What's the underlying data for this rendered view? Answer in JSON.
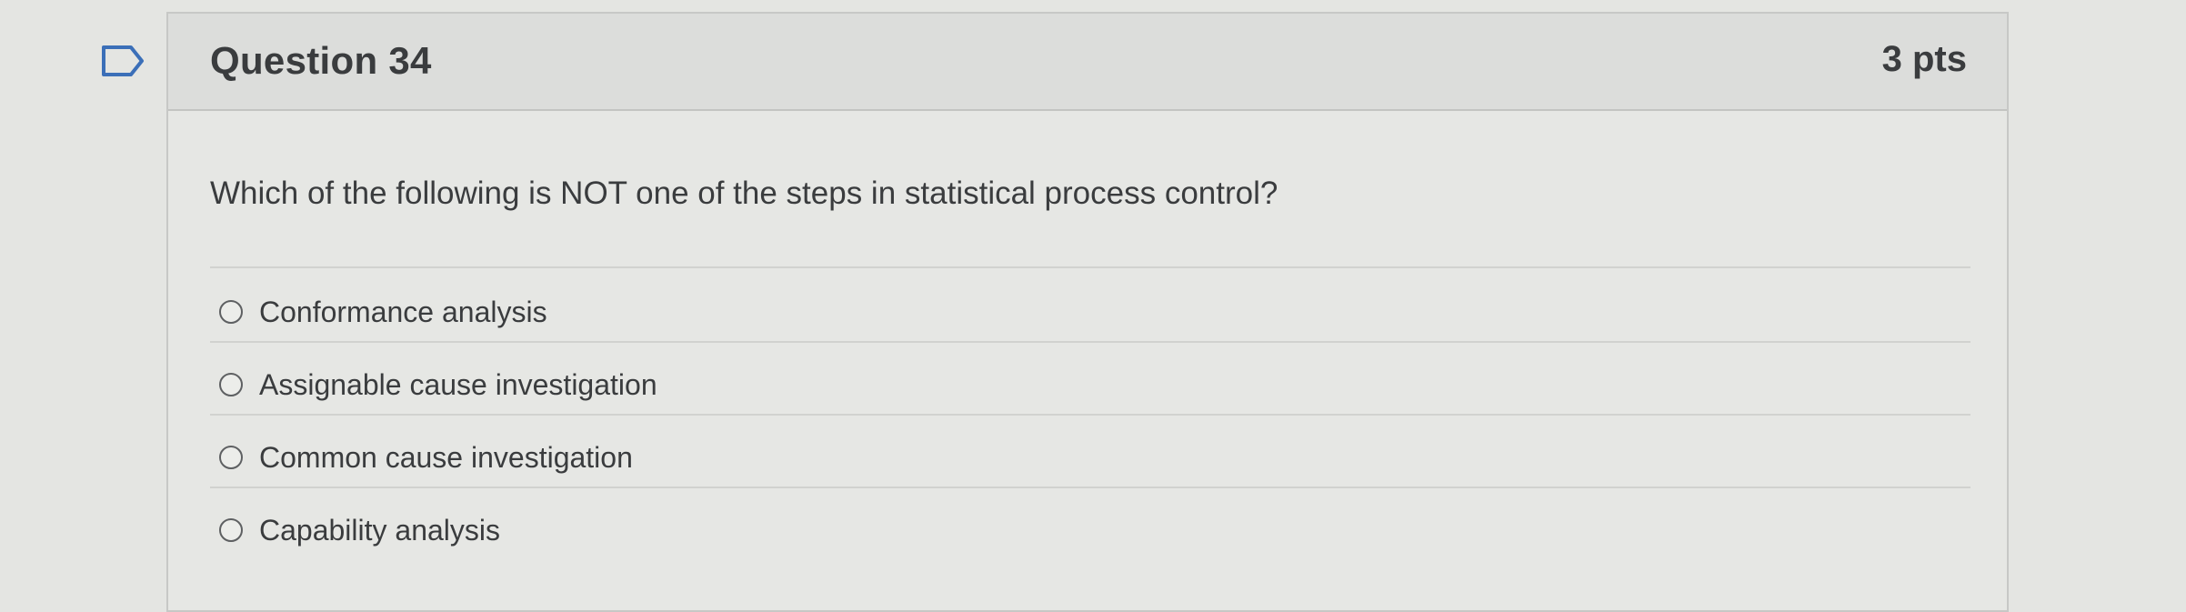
{
  "icons": {
    "flag": "flag-outline-icon",
    "radio": "radio-empty-icon"
  },
  "colors": {
    "background": "#e4e5e2",
    "header_bg": "#dcdddb",
    "text": "#3a3c3e"
  },
  "question": {
    "title": "Question 34",
    "points": "3 pts",
    "text": "Which of the following is NOT one of the steps in statistical process control?",
    "answers": [
      {
        "label": "Conformance analysis",
        "selected": false
      },
      {
        "label": "Assignable cause investigation",
        "selected": false
      },
      {
        "label": "Common cause investigation",
        "selected": false
      },
      {
        "label": "Capability analysis",
        "selected": false
      }
    ]
  }
}
